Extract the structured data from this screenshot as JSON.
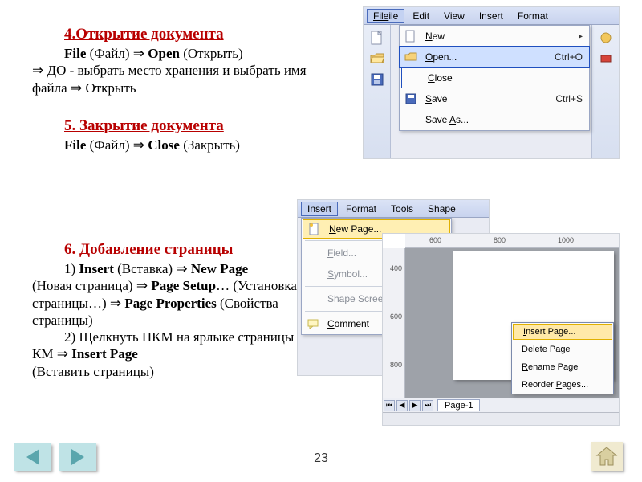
{
  "page_number": "23",
  "sections": {
    "s4": {
      "title": "4.Открытие документа",
      "line1_a": "File",
      "line1_b": " (Файл) ",
      "line1_c": "Open",
      "line1_d": " (Открыть)",
      "line2": " ДО - выбрать место хранения и выбрать имя файла ",
      "line2_end": " Открыть",
      "arrow": "⇒"
    },
    "s5": {
      "title": "5. Закрытие документа",
      "line1_a": "File",
      "line1_b": " (Файл) ",
      "line1_c": "Close",
      "line1_d": " (Закрыть)",
      "arrow": "⇒"
    },
    "s6": {
      "title": "6. Добавление страницы",
      "p1_pre": "1) ",
      "p1_insert": "Insert",
      "p1_insert_ru": " (Вставка) ",
      "p1_newpage": "New Page",
      "p1_newpage_ru": " (Новая страница) ",
      "p1_pagesetup": "Page Setup",
      "p1_dots": "… (Установка страницы…) ",
      "p1_pageprops": "Page Properties",
      "p1_pageprops_ru": " (Свойства страницы)",
      "p2_pre": "2) Щелкнуть ПКМ на ярлыке страницы ",
      "p2_km": " КМ ",
      "p2_insertpage": "Insert Page",
      "p2_insertpage_ru": " (Вставить страницы)",
      "arrow": "⇒"
    }
  },
  "file_menu": {
    "menubar": [
      "File",
      "Edit",
      "View",
      "Insert",
      "Format"
    ],
    "items": [
      {
        "label": "New",
        "shortcut": "",
        "icon": "new",
        "sub": true
      },
      {
        "label": "Open...",
        "shortcut": "Ctrl+O",
        "icon": "open",
        "hot": "O"
      },
      {
        "label": "Close",
        "shortcut": "",
        "hot": "C"
      },
      {
        "label": "Save",
        "shortcut": "Ctrl+S",
        "icon": "save",
        "hot": "S"
      },
      {
        "label": "Save As...",
        "shortcut": "",
        "hot": "A"
      }
    ]
  },
  "insert_menu": {
    "menubar": [
      "Insert",
      "Format",
      "Tools",
      "Shape"
    ],
    "items": [
      {
        "label": "New Page...",
        "icon": "newpage",
        "hot": "N",
        "selected": true
      },
      {
        "label": "Field...",
        "gray": true,
        "hot": "F"
      },
      {
        "label": "Symbol...",
        "gray": true,
        "hot": "S"
      },
      {
        "label": "Shape ScreenTip...",
        "gray": true
      },
      {
        "label": "Comment",
        "icon": "comment",
        "hot": "C"
      }
    ]
  },
  "page_panel": {
    "h_ticks": [
      "600",
      "800",
      "1000"
    ],
    "v_ticks": [
      "400",
      "600",
      "800"
    ],
    "tab_label": "Page-1",
    "ctx": [
      {
        "label": "Insert Page...",
        "selected": true
      },
      {
        "label": "Delete Page"
      },
      {
        "label": "Rename Page"
      },
      {
        "label": "Reorder Pages..."
      }
    ]
  },
  "nav": {
    "prev": "previous-slide",
    "next": "next-slide",
    "home": "home"
  }
}
